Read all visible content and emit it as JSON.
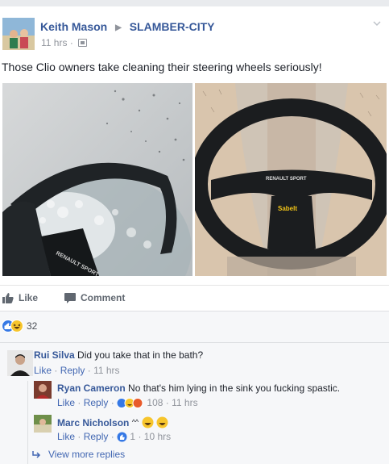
{
  "post": {
    "author": "Keith Mason",
    "group": "SLAMBER-CITY",
    "time": "11 hrs",
    "text": "Those Clio owners take cleaning their steering wheels seriously!",
    "wheel_badge_left": "RENAULT SPORT",
    "wheel_badge_right": "RENAULT SPORT",
    "wheel_brand": "Sabelt"
  },
  "actions": {
    "like": "Like",
    "comment": "Comment"
  },
  "reactions": {
    "count": "32",
    "icons": [
      "like-icon",
      "haha-icon"
    ]
  },
  "comments": [
    {
      "author": "Rui Silva",
      "text": "Did you take that in the bath?",
      "like": "Like",
      "reply": "Reply",
      "time": "11 hrs",
      "replies": [
        {
          "author": "Ryan Cameron",
          "text": "No that's him lying in the sink you fucking spastic.",
          "like": "Like",
          "reply": "Reply",
          "reaction_count": "108",
          "time": "11 hrs"
        },
        {
          "author": "Marc Nicholson",
          "text": "^^",
          "like": "Like",
          "reply": "Reply",
          "reaction_count": "1",
          "time": "10 hrs"
        }
      ],
      "view_more": "View more replies"
    }
  ],
  "colors": {
    "link": "#365899",
    "meta": "#90949c",
    "comments_bg": "#f6f7f9",
    "like_blue": "#3578e5",
    "haha_yellow": "#f7c52c",
    "angry_orange": "#e85a2a"
  }
}
